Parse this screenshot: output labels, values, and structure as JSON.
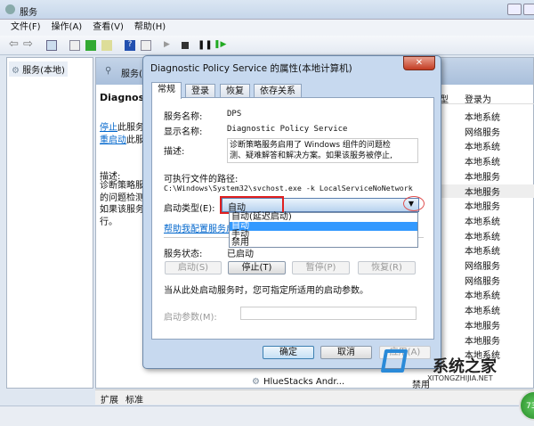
{
  "window": {
    "title": "服务"
  },
  "menu": [
    "文件(F)",
    "操作(A)",
    "查看(V)",
    "帮助(H)"
  ],
  "tree": {
    "root": "服务(本地)"
  },
  "middle": {
    "header": "服务(本地)",
    "service_title": "Diagnostic Policy Service",
    "stop_link": "停止",
    "stop_text": "此服务",
    "restart_link": "重启动",
    "restart_text": "此服务",
    "desc_label": "描述:",
    "desc_lines": [
      "诊断策略服务启用了",
      "的问题检测",
      "如果该服务",
      "行。"
    ],
    "column_partial": "型",
    "column_logon": "登录为",
    "logon_rows": [
      "本地系统",
      "网络服务",
      "本地系统",
      "本地系统",
      "本地服务",
      "本地服务",
      "本地服务",
      "本地系统",
      "本地系统",
      "本地系统",
      "网络服务",
      "网络服务",
      "本地系统",
      "本地系统",
      "本地服务",
      "本地服务",
      "本地系统"
    ],
    "bottom_row_name": "HlueStacks Andr...",
    "bottom_row_startup": "禁用",
    "tabs": [
      "扩展",
      "标准"
    ]
  },
  "dialog": {
    "title": "Diagnostic Policy Service 的属性(本地计算机)",
    "tabs": [
      "常规",
      "登录",
      "恢复",
      "依存关系"
    ],
    "service_name_label": "服务名称:",
    "service_name": "DPS",
    "display_name_label": "显示名称:",
    "display_name": "Diagnostic Policy Service",
    "desc_label": "描述:",
    "desc": "诊断策略服务启用了 Windows 组件的问题检测、疑难解答和解决方案。如果该服务被停止,",
    "path_label": "可执行文件的路径:",
    "path": "C:\\Windows\\System32\\svchost.exe -k LocalServiceNoNetwork",
    "startup_label": "启动类型(E):",
    "startup_value": "自动",
    "startup_options": [
      "自动(延迟启动)",
      "自动",
      "手动",
      "禁用"
    ],
    "help_link": "帮助我配置服务启动选项。",
    "status_label": "服务状态:",
    "status_value": "已启动",
    "start_btn": "启动(S)",
    "stop_btn": "停止(T)",
    "pause_btn": "暂停(P)",
    "resume_btn": "恢复(R)",
    "hint": "当从此处启动服务时，您可指定所适用的启动参数。",
    "params_label": "启动参数(M):",
    "params_value": "",
    "ok": "确定",
    "cancel": "取消",
    "apply": "应用(A)"
  },
  "watermark": {
    "text": "系统之家",
    "url": "XITONGZHIJIA.NET"
  },
  "badge": "73",
  "colors": {
    "highlight": "#3399ff",
    "link": "#0066cc",
    "annotation": "#e02020"
  }
}
